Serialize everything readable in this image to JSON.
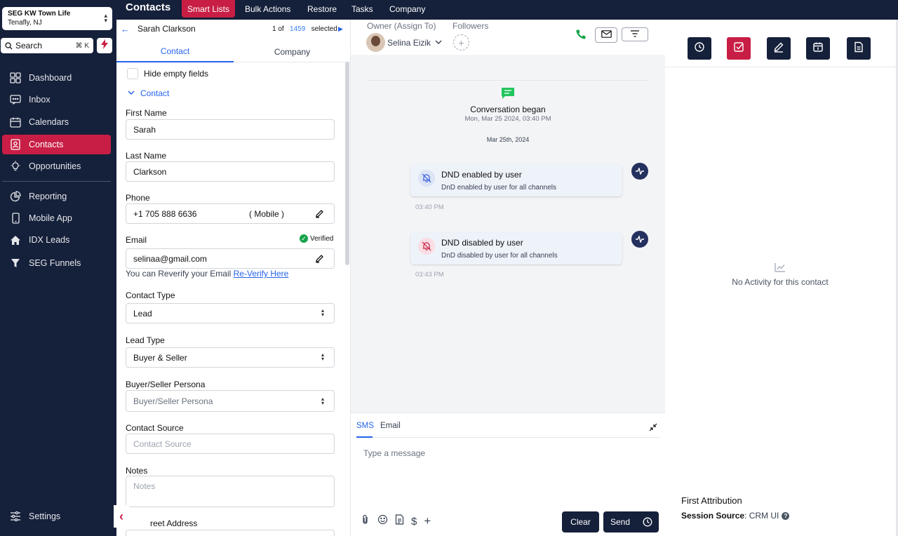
{
  "location": {
    "name": "SEG KW Town Life",
    "sub": "Tenafly, NJ"
  },
  "search": {
    "label": "Search",
    "shortcut": "⌘ K"
  },
  "sidebar": {
    "items": [
      {
        "label": "Dashboard",
        "icon": "dashboard-icon"
      },
      {
        "label": "Inbox",
        "icon": "inbox-icon"
      },
      {
        "label": "Calendars",
        "icon": "calendar-icon"
      },
      {
        "label": "Contacts",
        "icon": "contacts-icon",
        "active": true
      },
      {
        "label": "Opportunities",
        "icon": "lightbulb-icon"
      },
      {
        "label": "Reporting",
        "icon": "pie-chart-icon"
      },
      {
        "label": "Mobile App",
        "icon": "mobile-icon"
      },
      {
        "label": "IDX Leads",
        "icon": "home-icon"
      },
      {
        "label": "SEG Funnels",
        "icon": "filter-icon"
      }
    ],
    "settings": "Settings"
  },
  "topnav": {
    "title": "Contacts",
    "tabs": [
      "Smart Lists",
      "Bulk Actions",
      "Restore",
      "Tasks",
      "Company"
    ],
    "active_tab": "Smart Lists"
  },
  "record": {
    "name": "Sarah Clarkson",
    "pos": "1 of",
    "total": "1459",
    "selected": "selected"
  },
  "detail_tabs": [
    "Contact",
    "Company"
  ],
  "hide_empty": "Hide empty fields",
  "section": "Contact",
  "fields": {
    "first_name": {
      "label": "First Name",
      "value": "Sarah"
    },
    "last_name": {
      "label": "Last Name",
      "value": "Clarkson"
    },
    "phone": {
      "label": "Phone",
      "value": "+1 705 888 6636",
      "type": "( Mobile )"
    },
    "email": {
      "label": "Email",
      "value": "selinaa@gmail.com",
      "verified": "Verified"
    },
    "reverify_text": "You can Reverify your Email",
    "reverify_link": "Re-Verify Here",
    "contact_type": {
      "label": "Contact Type",
      "value": "Lead"
    },
    "lead_type": {
      "label": "Lead Type",
      "value": "Buyer & Seller"
    },
    "persona": {
      "label": "Buyer/Seller Persona",
      "placeholder": "Buyer/Seller Persona"
    },
    "source": {
      "label": "Contact Source",
      "placeholder": "Contact Source"
    },
    "notes": {
      "label": "Notes",
      "placeholder": "Notes"
    },
    "street": {
      "label": "reet Address"
    }
  },
  "conversation": {
    "owner_label": "Owner (Assign To)",
    "owner": "Selina Eizik",
    "followers_label": "Followers",
    "began": "Conversation began",
    "began_time": "Mon, Mar 25 2024, 03:40 PM",
    "date_divider": "Mar 25th, 2024",
    "activities": [
      {
        "title": "DND enabled by user",
        "sub": "DnD enabled by user for all channels",
        "time": "03:40 PM"
      },
      {
        "title": "DND disabled by user",
        "sub": "DnD disabled by user for all channels",
        "time": "03:43 PM"
      }
    ]
  },
  "composer": {
    "tabs": [
      "SMS",
      "Email"
    ],
    "placeholder": "Type a message",
    "clear": "Clear",
    "send": "Send"
  },
  "right": {
    "no_activity": "No Activity for this contact",
    "attribution_title": "First Attribution",
    "session_label": "Session Source",
    "session_value": ": CRM UI"
  },
  "colors": {
    "brand_red": "#c81e45",
    "navy": "#15203a",
    "link_blue": "#2563eb",
    "verified_green": "#16a34a"
  }
}
